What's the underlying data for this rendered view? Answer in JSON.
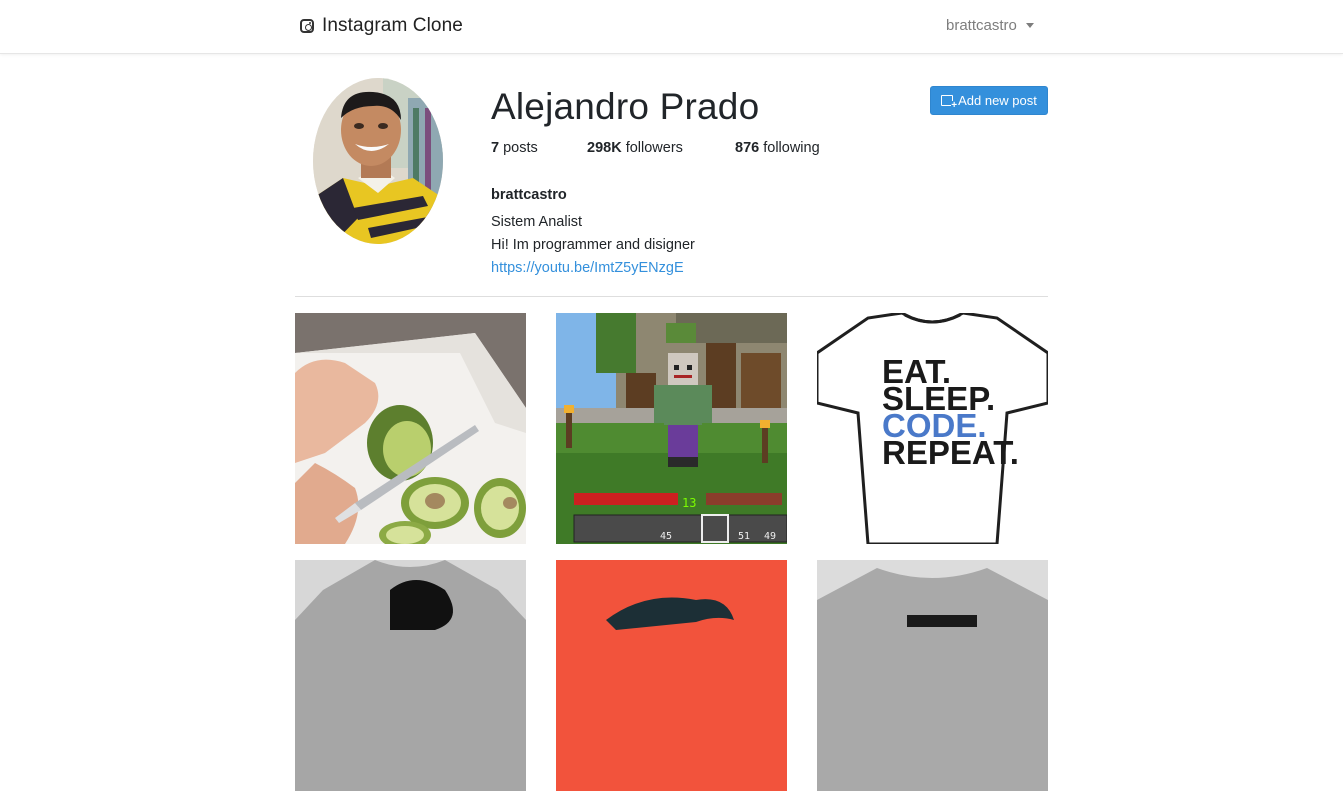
{
  "nav": {
    "brand": "Instagram Clone",
    "user": "brattcastro"
  },
  "profile": {
    "name": "Alejandro Prado",
    "add_post_label": "Add new post",
    "posts_count": "7",
    "posts_label": " posts",
    "followers_count": "298K",
    "followers_label": " followers",
    "following_count": "876",
    "following_label": " following",
    "username": "brattcastro",
    "title": "Sistem Analist",
    "description": "Hi! Im programmer and disigner",
    "url": "https://youtu.be/ImtZ5yENzgE"
  },
  "posts": {
    "tshirt_lines": [
      "EAT.",
      "SLEEP.",
      "CODE.",
      "REPEAT."
    ],
    "game_counters": [
      "13",
      "45",
      "51",
      "49"
    ]
  },
  "colors": {
    "accent": "#3490dc",
    "border": "#dedede",
    "muted": "#7d7d7d"
  }
}
